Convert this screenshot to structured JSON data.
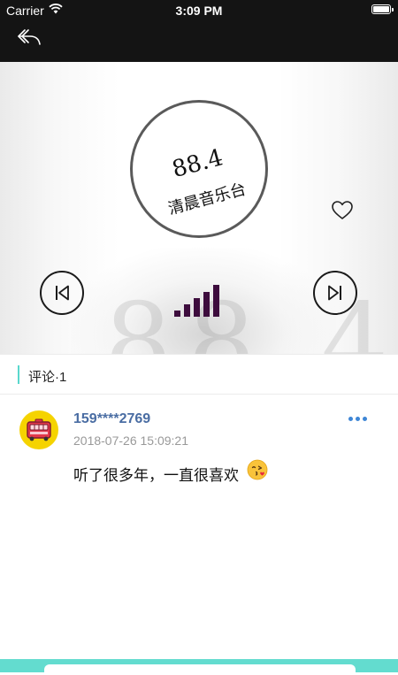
{
  "status_bar": {
    "carrier": "Carrier",
    "time": "3:09 PM"
  },
  "nav": {
    "back_icon": "back-arrow-icon"
  },
  "player": {
    "frequency": "88.4",
    "station_name": "清晨音乐台",
    "watermark": "88.4",
    "favorite_icon": "heart-outline-icon",
    "prev_icon": "skip-previous-icon",
    "next_icon": "skip-next-icon",
    "signal_icon": "signal-bars-icon",
    "signal_color": "#3d0c3d"
  },
  "comments_section": {
    "header": "评论·1",
    "accent_color": "#5ad8cd"
  },
  "comments": [
    {
      "username": "159****2769",
      "timestamp": "2018-07-26 15:09:21",
      "text": "听了很多年，一直很喜欢",
      "emoji": "kissing-face-emoji",
      "avatar_icon": "bus-avatar-icon",
      "more_icon": "more-dots-icon"
    }
  ],
  "bottom_bar": {
    "color": "#63dccf"
  }
}
